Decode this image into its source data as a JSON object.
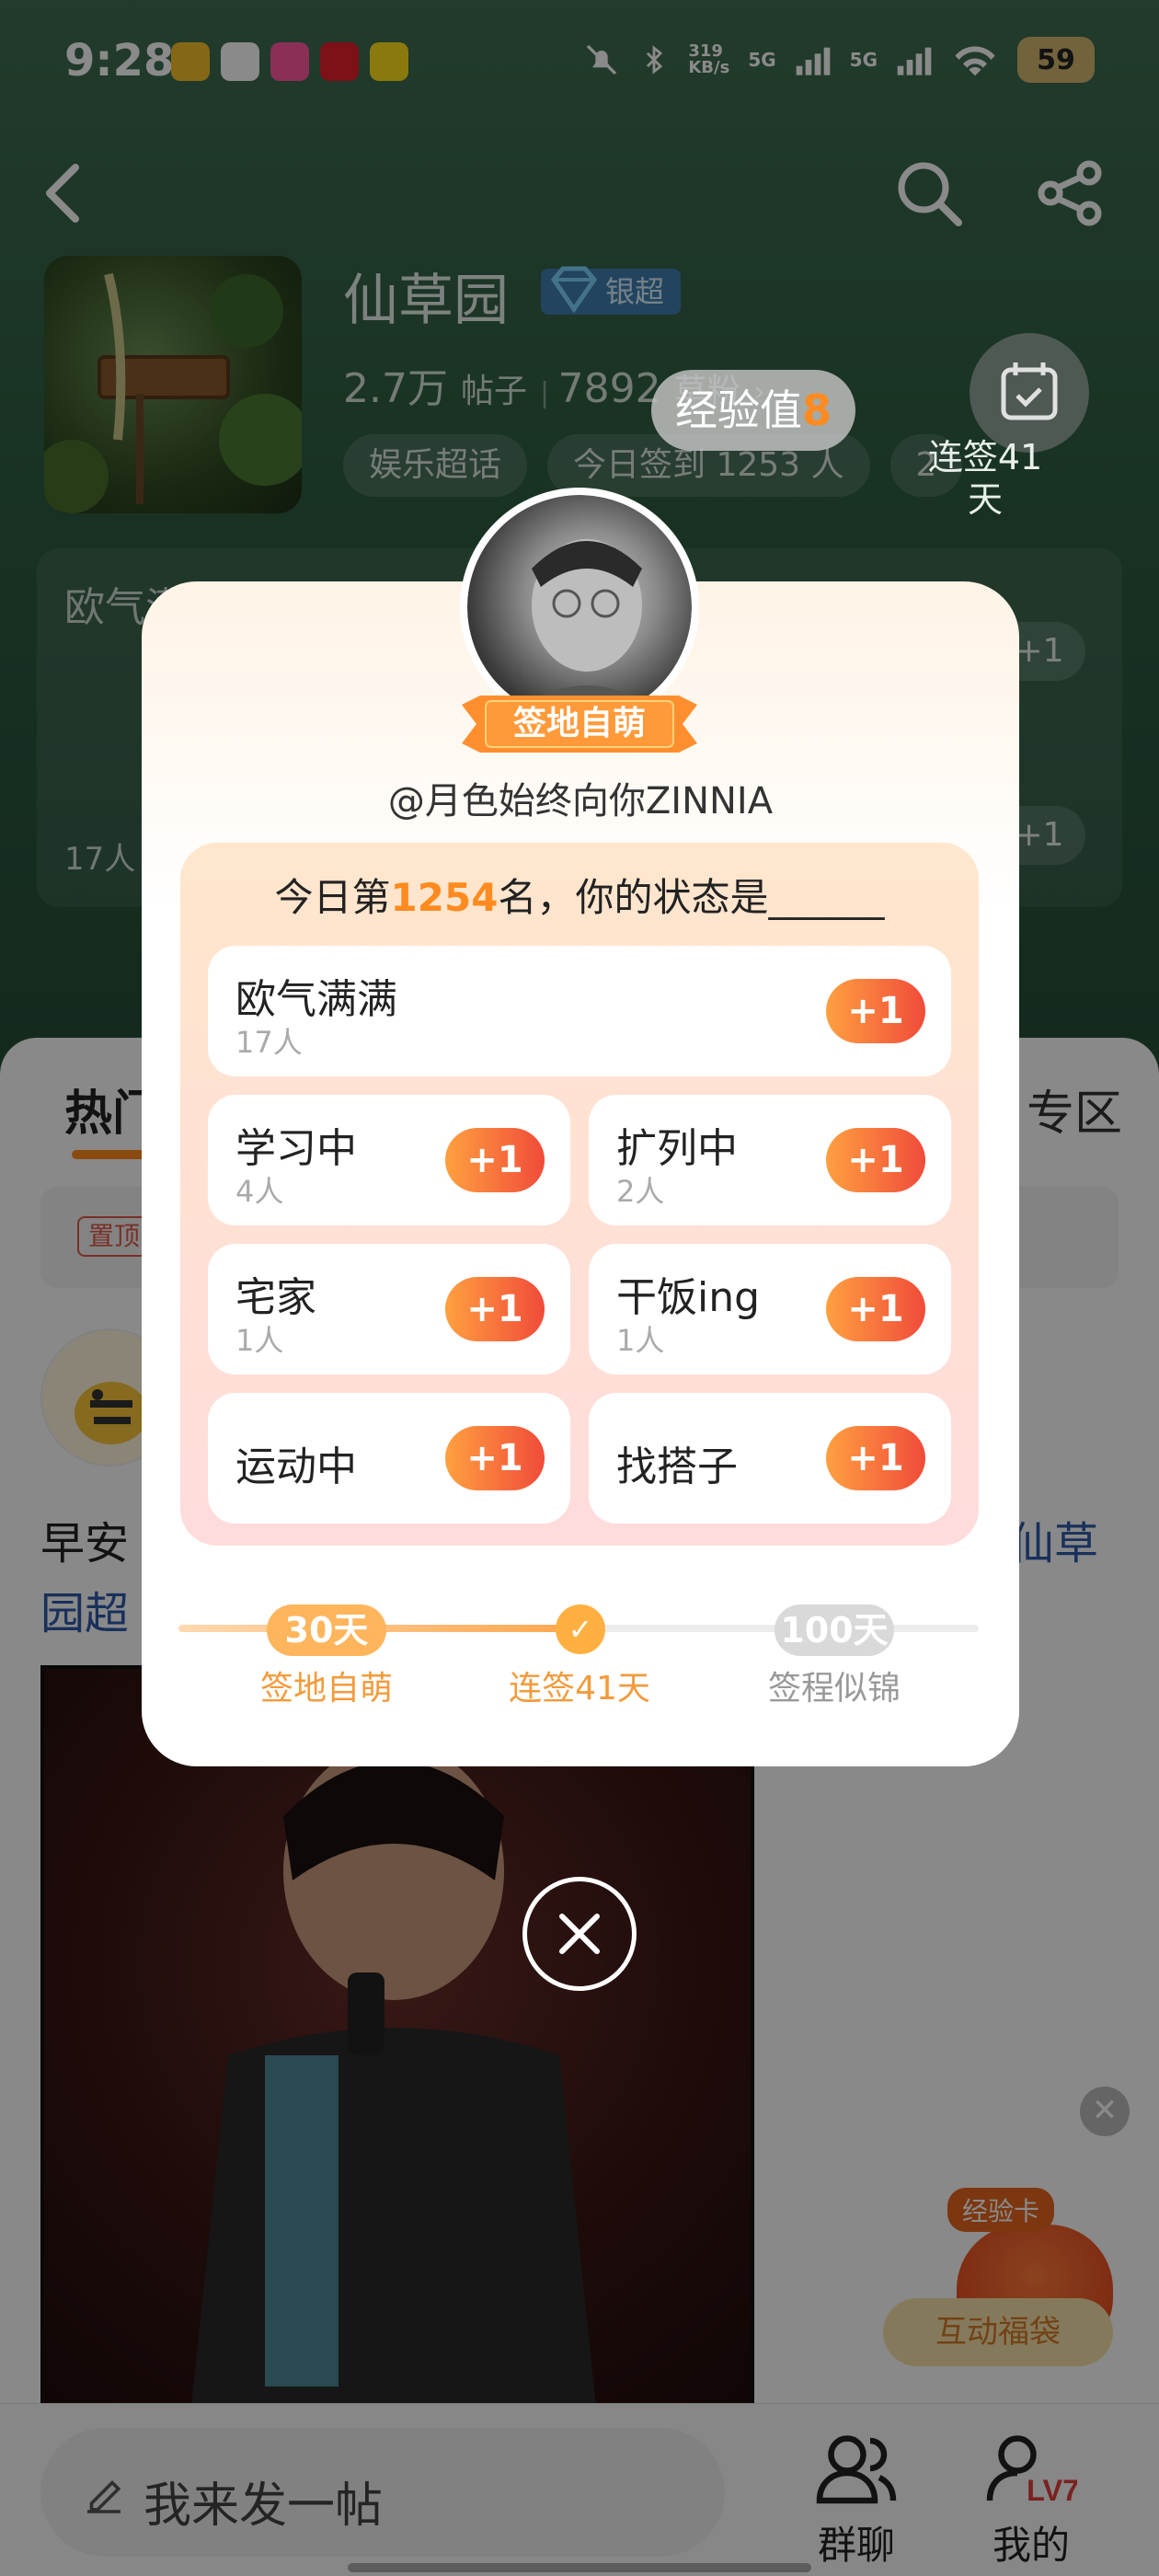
{
  "status_bar": {
    "time": "9:28",
    "net_speed": "319\nKB/s",
    "signal1": "5G",
    "signal2": "5G",
    "battery": "59"
  },
  "topic": {
    "title": "仙草园",
    "badge": "银超",
    "posts_count": "2.7万",
    "posts_unit": "帖子",
    "fans_count": "7892",
    "fans_unit": "草粉",
    "tags": [
      "娱乐超话",
      "今日签到 1253 人",
      "2"
    ],
    "checkin_streak": "连签41天"
  },
  "bg_panel": {
    "label1": "欧气满满",
    "count1": "17人",
    "plus": "+1"
  },
  "exp": {
    "label": "经验值",
    "value": "8"
  },
  "tabs": {
    "hot": "热门",
    "special": "专区"
  },
  "pinned": {
    "tag": "置顶"
  },
  "post": {
    "text_start": "早安",
    "text_end": "仙草",
    "text_line2": "园超"
  },
  "floating": {
    "card_tag": "经验卡",
    "card_label": "互动福袋"
  },
  "modal": {
    "level_title": "签地自萌",
    "username": "@月色始终向你ZINNIA",
    "prompt_prefix": "今日第",
    "rank": "1254",
    "prompt_suffix": "名，你的状态是______",
    "plus": "+1",
    "options": [
      {
        "label": "欧气满满",
        "count": "17人"
      },
      {
        "label": "学习中",
        "count": "4人"
      },
      {
        "label": "扩列中",
        "count": "2人"
      },
      {
        "label": "宅家",
        "count": "1人"
      },
      {
        "label": "干饭ing",
        "count": "1人"
      },
      {
        "label": "运动中",
        "count": ""
      },
      {
        "label": "找搭子",
        "count": ""
      }
    ],
    "milestones": [
      {
        "days": "30天",
        "name": "签地自萌"
      },
      {
        "days": "",
        "name": "连签41天"
      },
      {
        "days": "100天",
        "name": "签程似锦"
      }
    ]
  },
  "bottom_bar": {
    "compose": "我来发一帖",
    "group_chat": "群聊",
    "mine": "我的",
    "level": "LV7"
  },
  "colors": {
    "accent": "#ff8a1f",
    "plus_start": "#ffa040",
    "plus_end": "#f04b3a",
    "header_green": "#2f5e43"
  }
}
